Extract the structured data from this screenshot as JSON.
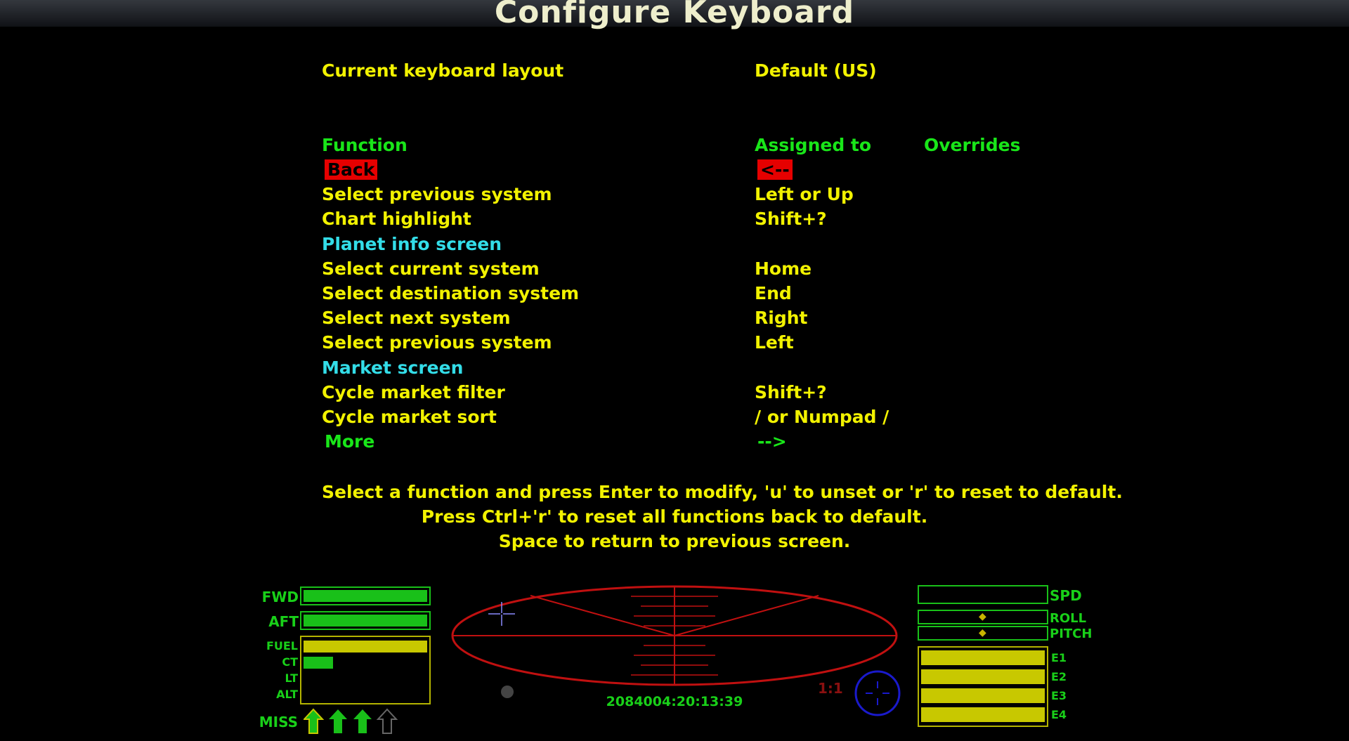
{
  "header": {
    "title": "Configure Keyboard"
  },
  "layout": {
    "label": "Current keyboard layout",
    "value": "Default (US)"
  },
  "columns": {
    "function": "Function",
    "assigned": "Assigned to",
    "overrides": "Overrides"
  },
  "rows": [
    {
      "func": "Back",
      "key": "<--",
      "kind": "selected"
    },
    {
      "func": "Select previous system",
      "key": "Left or Up",
      "kind": "item"
    },
    {
      "func": "Chart highlight",
      "key": "Shift+?",
      "kind": "item"
    },
    {
      "func": "Planet info screen",
      "key": "",
      "kind": "section"
    },
    {
      "func": "Select current system",
      "key": "Home",
      "kind": "item"
    },
    {
      "func": "Select destination system",
      "key": "End",
      "kind": "item"
    },
    {
      "func": "Select next system",
      "key": "Right",
      "kind": "item"
    },
    {
      "func": "Select previous system",
      "key": "Left",
      "kind": "item"
    },
    {
      "func": "Market screen",
      "key": "",
      "kind": "section"
    },
    {
      "func": "Cycle market filter",
      "key": "Shift+?",
      "kind": "item"
    },
    {
      "func": "Cycle market sort",
      "key": "/ or Numpad /",
      "kind": "item"
    },
    {
      "func": "More",
      "key": "-->",
      "kind": "more"
    }
  ],
  "instructions": {
    "line1": "Select a function and press Enter to modify, 'u' to unset or 'r' to reset to default.",
    "line2": "Press Ctrl+'r' to reset all functions back to default.",
    "line3": "Space to return to previous screen."
  },
  "hud": {
    "fwd_label": "FWD",
    "fwd_level": 1.0,
    "aft_label": "AFT",
    "aft_level": 1.0,
    "fuel_label": "FUEL",
    "fuel_level": 1.0,
    "ct_label": "CT",
    "ct_level": 0.24,
    "lt_label": "LT",
    "lt_level": 0,
    "alt_label": "ALT",
    "alt_level": 0,
    "miss_label": "MISS",
    "missiles": [
      "loaded",
      "ready",
      "ready",
      "empty"
    ],
    "clock": "2084004:20:13:39",
    "ratio": "1:1",
    "spd_label": "SPD",
    "spd_level": 0,
    "roll_label": "ROLL",
    "pitch_label": "PITCH",
    "energy_banks": [
      {
        "label": "E1",
        "level": 1.0
      },
      {
        "label": "E2",
        "level": 1.0
      },
      {
        "label": "E3",
        "level": 1.0
      },
      {
        "label": "E4",
        "level": 1.0
      }
    ],
    "colors": {
      "green": "#19c019",
      "yellow": "#c8c800",
      "red": "#c01010",
      "blue": "#1a1acc"
    }
  }
}
